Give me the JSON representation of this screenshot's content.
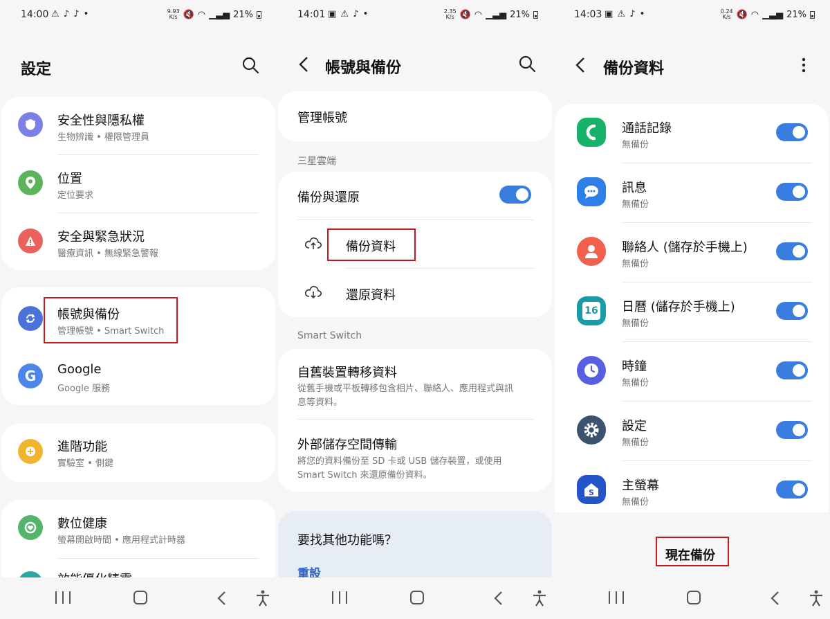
{
  "panel1": {
    "status": {
      "time": "14:00",
      "speed_top": "9.93",
      "speed_bottom": "K/s",
      "battery": "21%"
    },
    "title": "設定",
    "items": [
      {
        "title": "安全性與隱私權",
        "sub": "生物辨識 • 權限管理員",
        "icon": "shield-icon",
        "color": "#7b7fe8"
      },
      {
        "title": "位置",
        "sub": "定位要求",
        "icon": "location-pin-icon",
        "color": "#5bb35b"
      },
      {
        "title": "安全與緊急狀況",
        "sub": "醫療資訊 • 無線緊急警報",
        "icon": "emergency-icon",
        "color": "#e8625b"
      },
      {
        "title": "帳號與備份",
        "sub": "管理帳號 • Smart Switch",
        "icon": "sync-icon",
        "color": "#4b72d8"
      },
      {
        "title": "Google",
        "sub": "Google 服務",
        "icon": "google-icon",
        "color": "#4d86ea"
      },
      {
        "title": "進階功能",
        "sub": "實驗室 • 側鍵",
        "icon": "gear-plus-icon",
        "color": "#f2b530"
      },
      {
        "title": "數位健康",
        "sub": "螢幕開啟時間 • 應用程式計時器",
        "icon": "wellbeing-icon",
        "color": "#55b56b"
      },
      {
        "title": "效能優化精靈",
        "icon": "care-icon",
        "color": "#29a8a3"
      }
    ]
  },
  "panel2": {
    "status": {
      "time": "14:01",
      "speed_top": "2.35",
      "speed_bottom": "K/s",
      "battery": "21%"
    },
    "title": "帳號與備份",
    "manage": "管理帳號",
    "section_cloud": "三星雲端",
    "backup_restore": "備份與還原",
    "backup_data": "備份資料",
    "restore_data": "還原資料",
    "section_smart": "Smart Switch",
    "transfer_title": "自舊裝置轉移資料",
    "transfer_sub1": "從舊手機或平板轉移包含相片、聯絡人、應用程式與訊",
    "transfer_sub2": "息等資料。",
    "external_title": "外部儲存空間傳輸",
    "external_sub1": "將您的資料備份至 SD 卡或 USB 儲存裝置，或使用",
    "external_sub2": "Smart Switch 來還原備份資料。",
    "looking": "要找其他功能嗎？",
    "reset": "重設"
  },
  "panel3": {
    "status": {
      "time": "14:03",
      "speed_top": "0.24",
      "speed_bottom": "K/s",
      "battery": "21%"
    },
    "title": "備份資料",
    "items": [
      {
        "title": "通話記錄",
        "sub": "無備份",
        "icon": "phone-icon",
        "color": "#17b26a"
      },
      {
        "title": "訊息",
        "sub": "無備份",
        "icon": "message-icon",
        "color": "#2f7fe8"
      },
      {
        "title": "聯絡人 (儲存於手機上)",
        "sub": "無備份",
        "icon": "contact-icon",
        "color": "#f0604d"
      },
      {
        "title": "日曆 (儲存於手機上)",
        "sub": "無備份",
        "icon": "calendar-icon",
        "color": "#1b9aa8",
        "day": "16"
      },
      {
        "title": "時鐘",
        "sub": "無備份",
        "icon": "clock-icon",
        "color": "#5760e0"
      },
      {
        "title": "設定",
        "sub": "無備份",
        "icon": "settings-icon",
        "color": "#3d5270"
      },
      {
        "title": "主螢幕",
        "sub": "無備份",
        "icon": "home-icon",
        "color": "#2455c8",
        "letter": "S"
      }
    ],
    "backup_now": "現在備份"
  }
}
